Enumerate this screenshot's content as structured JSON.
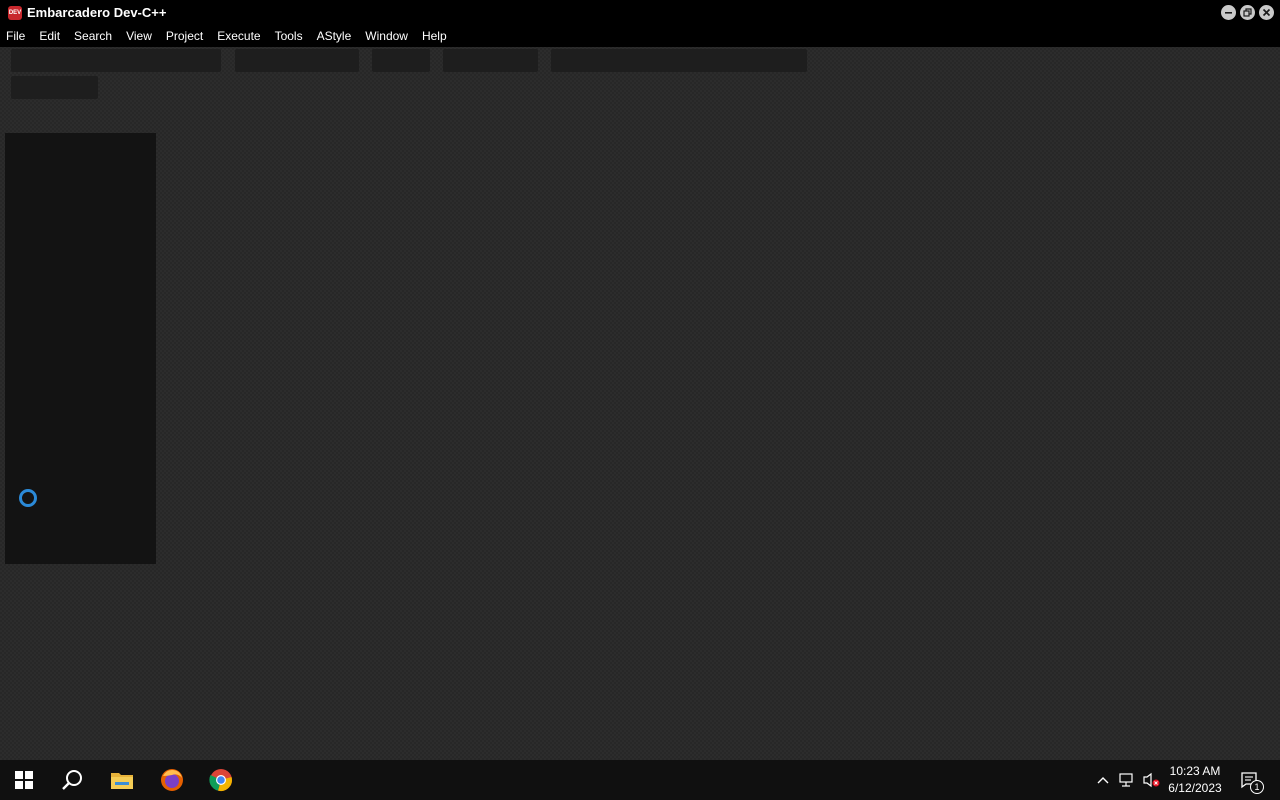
{
  "window": {
    "title": "Embarcadero Dev-C++",
    "app_icon_text": "DEV",
    "controls": [
      "minimize",
      "restore",
      "close"
    ]
  },
  "menu": {
    "items": [
      "File",
      "Edit",
      "Search",
      "View",
      "Project",
      "Execute",
      "Tools",
      "AStyle",
      "Window",
      "Help"
    ]
  },
  "taskbar": {
    "apps": [
      "windows-start-icon",
      "search-icon",
      "file-explorer-icon",
      "firefox-icon",
      "chrome-icon"
    ],
    "tray": {
      "chevron": "^",
      "time": "10:23 AM",
      "date": "6/12/2023",
      "notification_count": "1"
    }
  },
  "colors": {
    "titlebar": "#000000",
    "workspace": "#272727",
    "spinner": "#2b8ad8"
  }
}
